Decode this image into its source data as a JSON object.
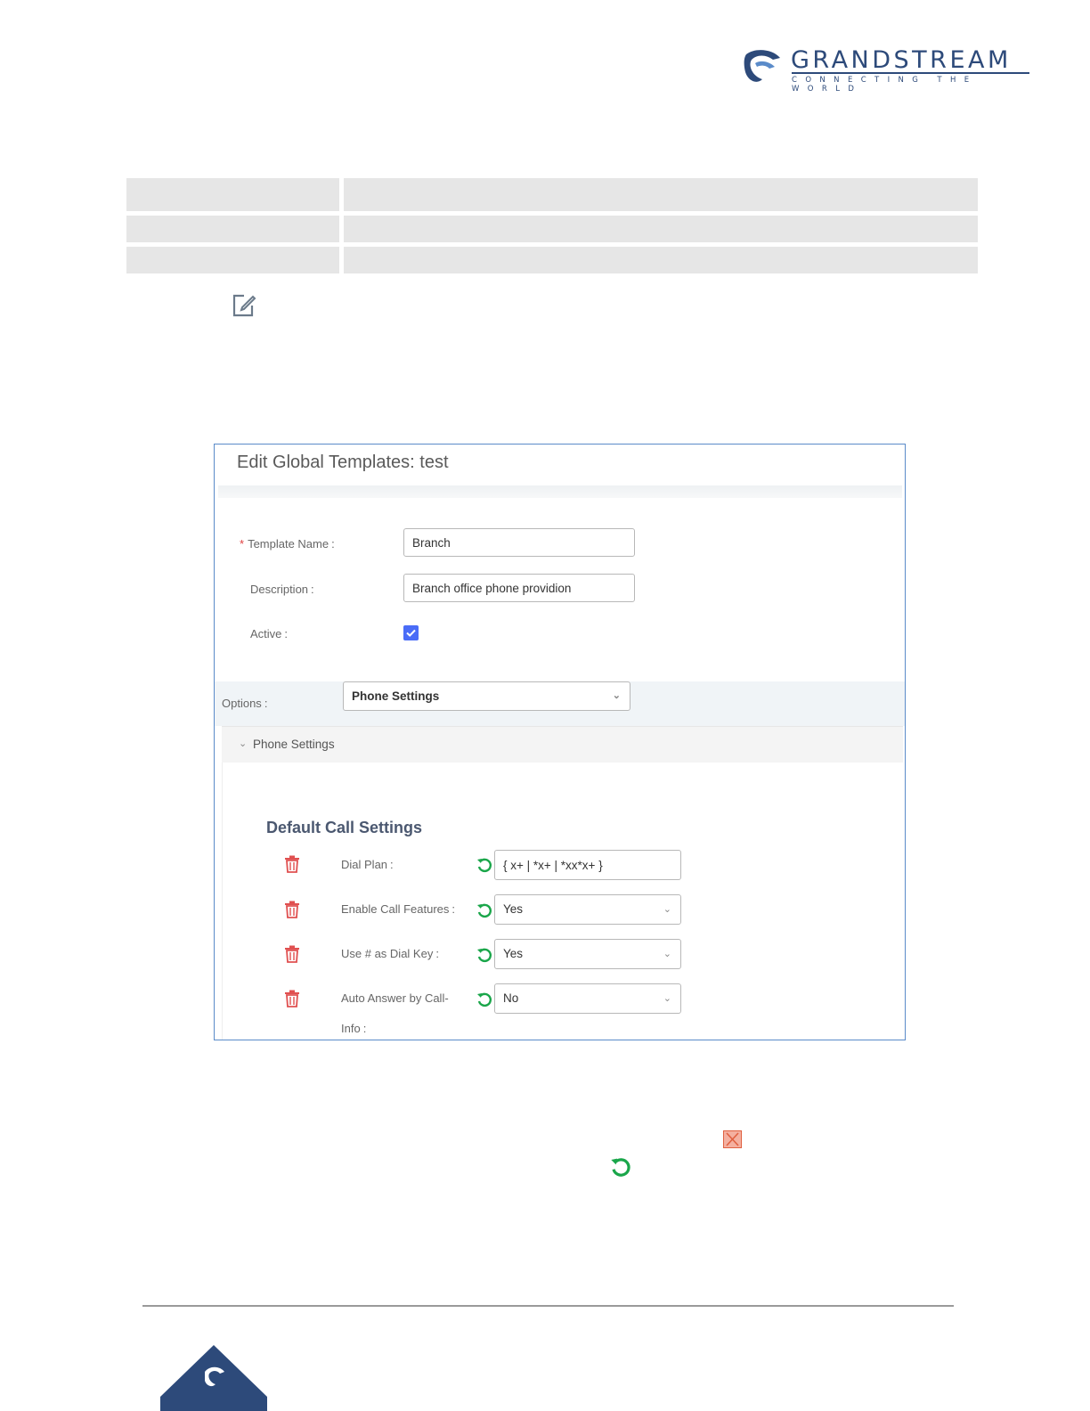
{
  "logo": {
    "wordmark": "GRANDSTREAM",
    "tagline": "CONNECTING THE WORLD",
    "brand_color": "#2d4a7a"
  },
  "icons": {
    "edit": "edit-icon",
    "delete": "trash-icon",
    "reset": "reset-icon",
    "close": "close-icon"
  },
  "panel": {
    "title": "Edit Global Templates: test",
    "template_name": {
      "label": "Template Name",
      "required_mark": "*",
      "value": "Branch"
    },
    "description": {
      "label": "Description",
      "value": "Branch office phone providion"
    },
    "active": {
      "label": "Active",
      "checked": true
    },
    "options": {
      "label": "Options",
      "value": "Phone Settings"
    },
    "section_header": "Phone Settings",
    "section_title": "Default Call Settings",
    "settings": [
      {
        "label": "Dial Plan",
        "value": "{ x+ | *x+ | *xx*x+ }",
        "kind": "text"
      },
      {
        "label": "Enable Call Features",
        "value": "Yes",
        "kind": "select"
      },
      {
        "label": "Use # as Dial Key",
        "value": "Yes",
        "kind": "select"
      },
      {
        "label": "Auto Answer by Call-",
        "label2": "Info",
        "value": "No",
        "kind": "select"
      }
    ],
    "colon": ":"
  },
  "colors": {
    "accent": "#4a6cf7",
    "delete": "#e05050",
    "reset": "#1aa64a",
    "border": "#5a8bc9"
  }
}
